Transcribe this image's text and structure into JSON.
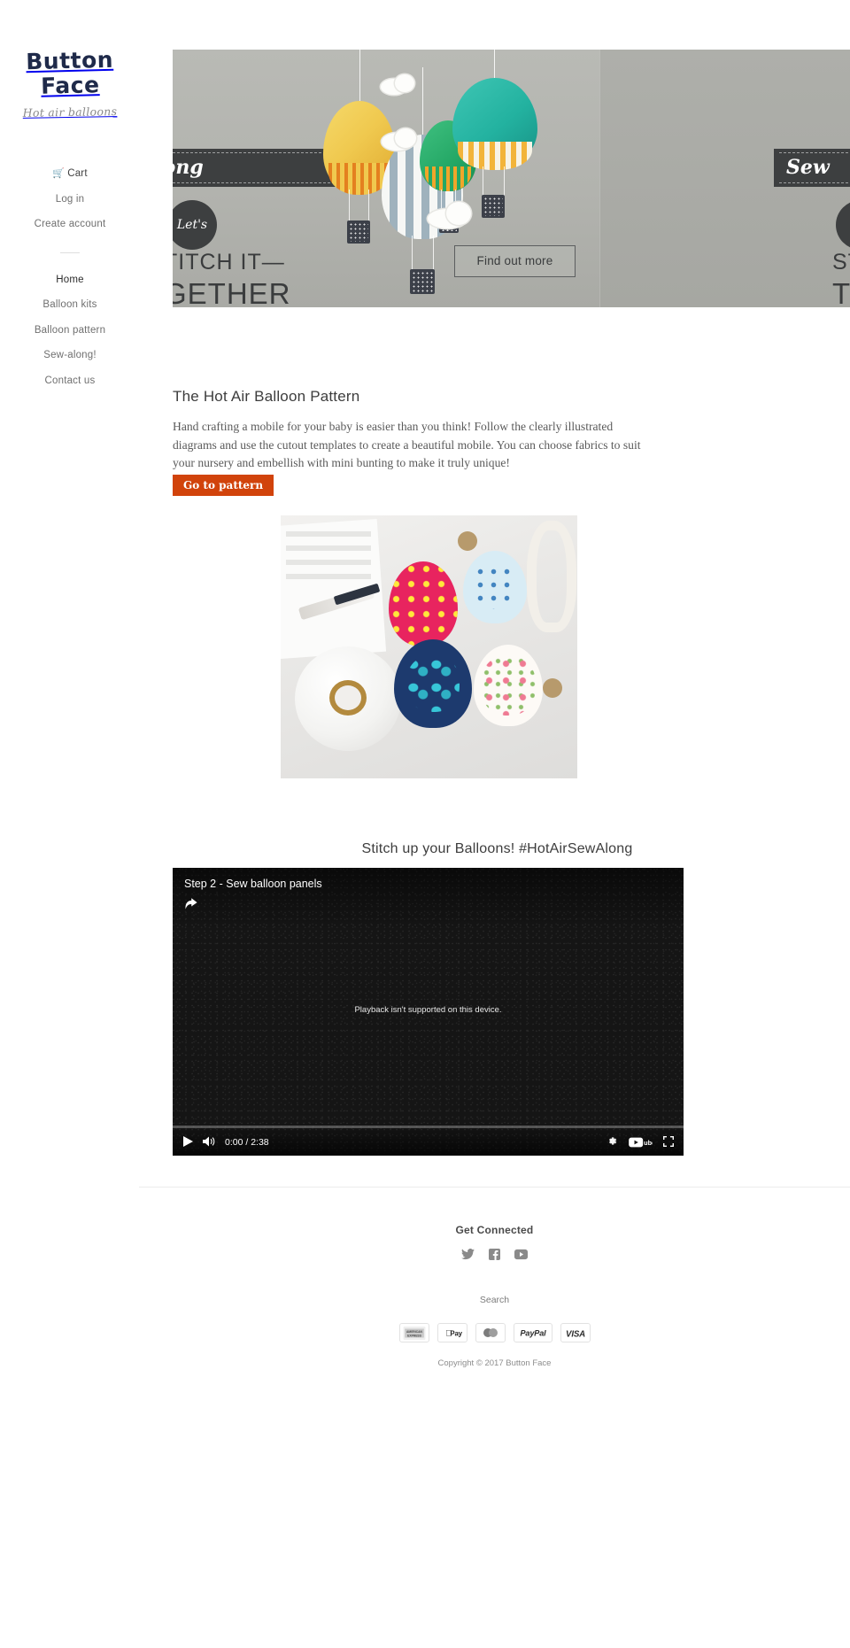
{
  "brand": {
    "name": "Button Face",
    "tagline": "Hot air balloons",
    "logo_color": "#1f2a4a",
    "tagline_color": "#8a8a8a"
  },
  "sidebar": {
    "account_items": [
      {
        "label": "Cart",
        "icon": "shopping-cart-icon"
      },
      {
        "label": "Log in",
        "icon": ""
      },
      {
        "label": "Create account",
        "icon": ""
      }
    ],
    "nav_items": [
      {
        "label": "Home",
        "active": true
      },
      {
        "label": "Balloon kits",
        "active": false
      },
      {
        "label": "Balloon pattern",
        "active": false
      },
      {
        "label": "Sew-along!",
        "active": false
      },
      {
        "label": "Contact us",
        "active": false
      }
    ]
  },
  "hero": {
    "ribbon_text_left": "w-along",
    "ribbon_text_right": "Sew",
    "circle_text": "Let's",
    "headline_line1": "TITCH IT—",
    "headline_line2": "GETHER",
    "headline_right_line1": "ST",
    "headline_right_line2": "TOG",
    "cta_label": "Find out more",
    "background_color": "#b4b5b0",
    "ribbon_color": "#3d3f40"
  },
  "main": {
    "heading": "The Hot Air Balloon Pattern",
    "paragraph": "Hand crafting a mobile for your baby is easier than you think! Follow the clearly illustrated diagrams and use the cutout templates to create a beautiful mobile. You can choose fabrics to suit your nursery and embellish with mini bunting to make it truly unique!",
    "cta_label": "Go to pattern",
    "cta_color": "#d1430b",
    "photo_alt": "balloon-craft-supplies-photo"
  },
  "video_section": {
    "title": "Stitch up your Balloons! #HotAirSewAlong",
    "player": {
      "video_title": "Step 2 - Sew balloon panels",
      "unsupported_message": "Playback isn't supported on this device.",
      "current_time": "0:00",
      "duration": "2:38",
      "time_display": "0:00 / 2:38",
      "provider": "YouTube",
      "controls": [
        "play-button",
        "volume-button",
        "settings-button",
        "youtube-logo",
        "fullscreen-button"
      ]
    }
  },
  "footer": {
    "get_connected": "Get Connected",
    "social": [
      {
        "name": "twitter-icon",
        "label": "Twitter"
      },
      {
        "name": "facebook-icon",
        "label": "Facebook"
      },
      {
        "name": "youtube-icon",
        "label": "YouTube"
      }
    ],
    "search_label": "Search",
    "payment_methods": [
      {
        "name": "american-express",
        "label": "AMERICAN\nEXPRESS"
      },
      {
        "name": "apple-pay",
        "label": "Pay"
      },
      {
        "name": "mastercard",
        "label": ""
      },
      {
        "name": "paypal",
        "label": "PayPal"
      },
      {
        "name": "visa",
        "label": "VISA"
      }
    ],
    "copyright": "Copyright © 2017 Button Face"
  }
}
